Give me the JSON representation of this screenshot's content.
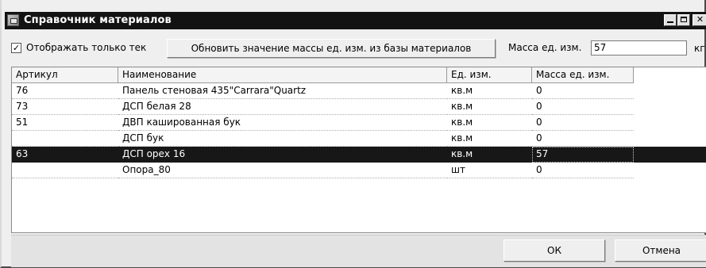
{
  "window": {
    "title": "Справочник материалов",
    "minimize": "_",
    "close": "✕"
  },
  "toolbar": {
    "checkbox_checked": true,
    "checkbox_mark": "✓",
    "checkbox_label": "Отображать только тек",
    "refresh_button": "Обновить значение массы ед. изм. из базы материалов",
    "mass_label": "Масса ед. изм.",
    "mass_value": "57",
    "unit": "кг"
  },
  "table": {
    "columns": [
      "Артикул",
      "Наименование",
      "Ед. изм.",
      "Масса ед. изм."
    ],
    "rows": [
      {
        "article": "76",
        "name": "Панель стеновая 435\"Carrara\"Quartz",
        "unit": "кв.м",
        "mass": "0"
      },
      {
        "article": "73",
        "name": "ДСП белая 28",
        "unit": "кв.м",
        "mass": "0"
      },
      {
        "article": "51",
        "name": "ДВП кашированная бук",
        "unit": "кв.м",
        "mass": "0"
      },
      {
        "article": "",
        "name": "ДСП бук",
        "unit": "кв.м",
        "mass": "0"
      },
      {
        "article": "63",
        "name": "ДСП орех 16",
        "unit": "кв.м",
        "mass": "57"
      },
      {
        "article": "",
        "name": "Опора_80",
        "unit": "шт",
        "mass": "0"
      }
    ],
    "selected_row": 4
  },
  "footer": {
    "ok": "ОК",
    "cancel": "Отмена"
  }
}
